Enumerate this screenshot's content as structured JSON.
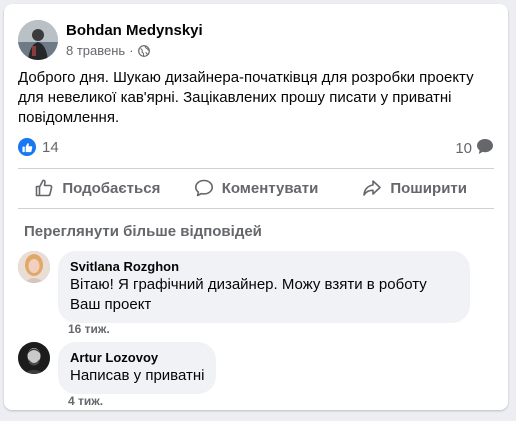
{
  "post": {
    "author": "Bohdan Medynskyi",
    "date": "8 травень",
    "date_separator": "·",
    "privacy_icon": "globe-icon",
    "text": "Доброго дня. Шукаю дизайнера-початківця для розробки проекту для невеликої кав'ярні. Зацікавлених прошу писати у приватні повідомлення.",
    "reaction_icon": "like-icon",
    "reaction_count": "14",
    "comment_count": "10",
    "comment_count_icon": "comment-bubble-icon"
  },
  "actions": {
    "like_label": "Подобається",
    "comment_label": "Коментувати",
    "share_label": "Поширити"
  },
  "comments": {
    "view_more_label": "Переглянути більше відповідей",
    "items": [
      {
        "author": "Svitlana Rozghon",
        "text_line1": "Вітаю! Я графічний дизайнер. Можу взяти в роботу",
        "text_line2": "Ваш проект",
        "time": "16 тиж."
      },
      {
        "author": "Artur Lozovoy",
        "text_line1": "Написав у приватні",
        "time": "4 тиж."
      }
    ]
  },
  "colors": {
    "accent": "#1877f2",
    "secondary_text": "#65676b",
    "bubble": "#f0f2f5"
  }
}
